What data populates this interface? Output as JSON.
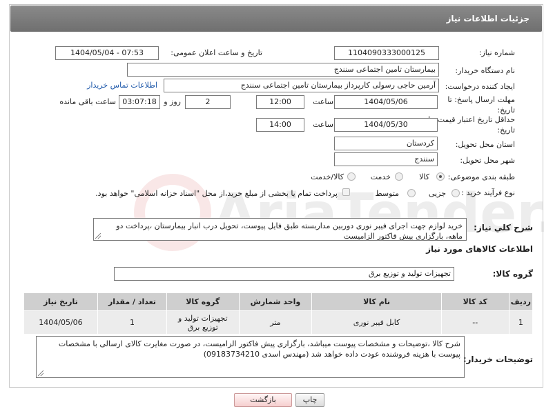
{
  "header": {
    "title": "جزئیات اطلاعات نیاز"
  },
  "fields": {
    "need_number_label": "شماره نیاز:",
    "need_number": "1104090333000125",
    "announce_label": "تاریخ و ساعت اعلان عمومی:",
    "announce_value": "1404/05/04 - 07:53",
    "buyer_org_label": "نام دستگاه خریدار:",
    "buyer_org": "بیمارستان تامین اجتماعی سنندج",
    "creator_label": "ایجاد کننده درخواست:",
    "creator": "آرمین حاجی رسولی کارپرداز بیمارستان تامین اجتماعی سنندج",
    "contact_link": "اطلاعات تماس خریدار",
    "deadline_label": "مهلت ارسال پاسخ: تا تاریخ:",
    "deadline_date": "1404/05/06",
    "time_label": "ساعت",
    "deadline_time": "12:00",
    "days_value": "2",
    "days_label": "روز و",
    "remaining_time": "03:07:18",
    "remaining_label": "ساعت باقی مانده",
    "validity_label": "حداقل تاریخ اعتبار قیمت: تا تاریخ:",
    "validity_date": "1404/05/30",
    "validity_time": "14:00",
    "province_label": "استان محل تحویل:",
    "province": "کردستان",
    "city_label": "شهر محل تحویل:",
    "city": "سنندج",
    "category_label": "طبقه بندی موضوعی:",
    "category_options": [
      "کالا",
      "خدمت",
      "کالا/خدمت"
    ],
    "process_label": "نوع فرآیند خرید :",
    "process_options": [
      "جزیی",
      "متوسط"
    ],
    "payment_note": "پرداخت تمام یا بخشی از مبلغ خرید،از محل \"اسناد خزانه اسلامی\" خواهد بود.",
    "description_label": "شرح کلي نياز:",
    "description": "خرید لوازم جهت اجرای فیبر نوری دوربین مداربسته طبق فایل پیوست، تحویل درب انبار بیمارستان ،پرداخت دو ماهه، بارگزاری پیش فاکتور الزامیست"
  },
  "goods": {
    "section_title": "اطلاعات کالاهای مورد نیاز",
    "group_label": "گروه کالا:",
    "group_value": "تجهیزات تولید و توزیع برق",
    "columns": [
      "ردیف",
      "کد کالا",
      "نام کالا",
      "واحد شمارش",
      "گروه کالا",
      "تعداد / مقدار",
      "تاریخ نیاز"
    ],
    "rows": [
      [
        "1",
        "--",
        "کابل فیبر نوری",
        "متر",
        "تجهیزات تولید و توزیع برق",
        "1",
        "1404/05/06"
      ]
    ]
  },
  "buyer_notes": {
    "label": "توضیحات خریدار:",
    "text": "شرح کالا ،توضیحات و مشخصات پیوست میباشد، بارگزاری پیش فاکتور الزامیست، در صورت مغایرت کالای ارسالی با مشخصات پیوست با هزینه فروشنده عودت داده خواهد شد   (مهندس اسدی 09183734210)"
  },
  "buttons": {
    "print": "چاپ",
    "back": "بازگشت"
  },
  "watermark": {
    "text": "AriaTender.neT"
  }
}
